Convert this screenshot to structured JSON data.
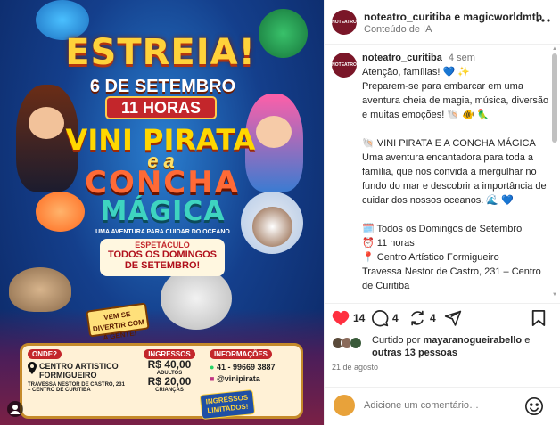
{
  "poster": {
    "headline": "ESTREIA!",
    "date": "6 DE SETEMBRO",
    "time": "11 HORAS",
    "title_line1": "VINI PIRATA",
    "title_connector": "e a",
    "title_line2": "CONCHA",
    "title_line3": "MÁGICA",
    "subtitle": "UMA AVENTURA PARA CUIDAR DO OCEANO",
    "show_label": "ESPETÁCULO",
    "show_text": "TODOS OS DOMINGOS DE SETEMBRO!",
    "fun_badge": "VEM SE DIVERTIR COM A GENTE!",
    "where_tag": "ONDE?",
    "venue_name": "CENTRO ARTISTICO FORMIGUEIRO",
    "venue_address": "TRAVESSA NESTOR DE CASTRO, 231 – CENTRO DE CURITIBA",
    "tickets_tag": "INGRESSOS",
    "adult_price": "R$ 40,00",
    "adult_label": "ADULTOS",
    "child_price": "R$ 20,00",
    "child_label": "CRIANÇAS",
    "info_tag": "INFORMAÇÕES",
    "phone": "41 - 99669 3887",
    "instagram": "@vinipirata",
    "limited": "INGRESSOS LIMITADOS!"
  },
  "header": {
    "avatar_text": "NOTEATRO",
    "account_names": "noteatro_curitiba e magicworldmtb",
    "subtitle": "Conteúdo de IA",
    "more_icon": "more-horizontal-icon"
  },
  "caption": {
    "username": "noteatro_curitiba",
    "time": "4 sem",
    "lines": [
      "Atenção, famílias! 💙 ✨",
      "Preparem-se para embarcar em uma aventura cheia de magia, música, diversão e muitas emoções! 🐚 🐠 🦜",
      "",
      "🐚 VINI PIRATA E A CONCHA MÁGICA",
      "Uma aventura encantadora para toda a família, que nos convida a mergulhar no fundo do mar e descobrir a importância de cuidar dos nossos oceanos. 🌊 💙",
      "",
      "🗓️ Todos os Domingos de Setembro",
      "⏰ 11 horas",
      "📍 Centro Artístico Formigueiro",
      "Travessa Nestor de Castro, 231 – Centro de Curitiba"
    ]
  },
  "actions": {
    "likes": "14",
    "comments": "4",
    "reposts": "4"
  },
  "liked_by": {
    "prefix": "Curtido por",
    "user": "mayaranogueirabello",
    "middle": "e",
    "others": "outras 13 pessoas"
  },
  "date": "21 de agosto",
  "comment": {
    "placeholder": "Adicione um comentário…"
  },
  "colors": {
    "like": "#ff3040",
    "text": "#262626",
    "muted": "#737373",
    "brand_avatar": "#7a1628"
  }
}
